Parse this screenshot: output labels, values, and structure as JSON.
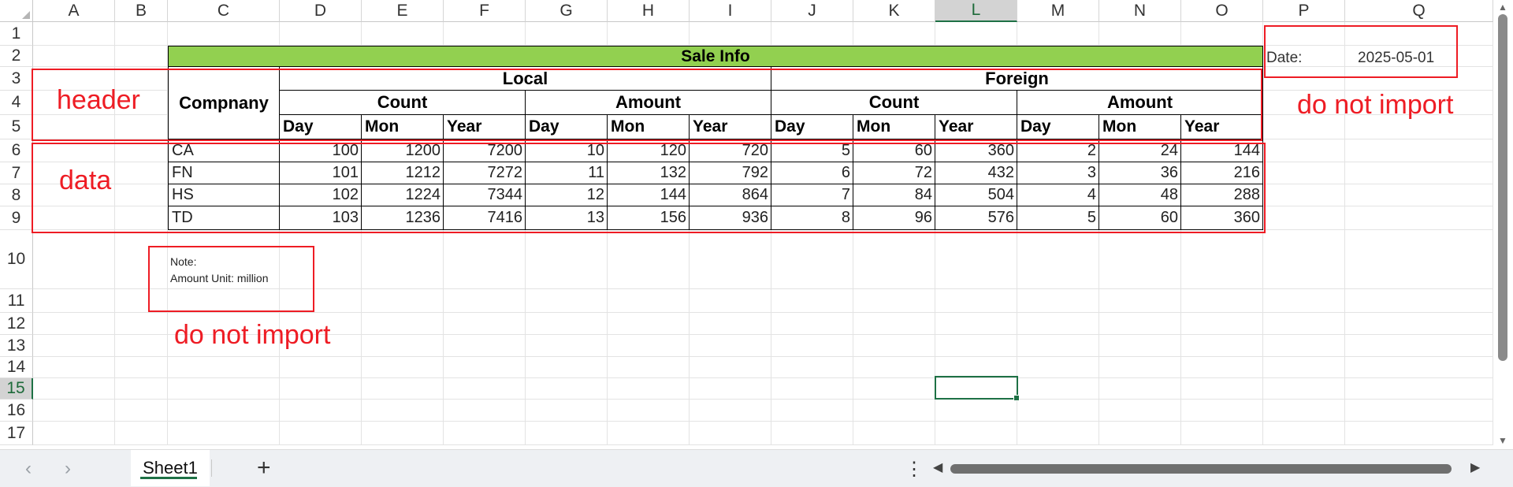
{
  "columns": [
    "A",
    "B",
    "C",
    "D",
    "E",
    "F",
    "G",
    "H",
    "I",
    "J",
    "K",
    "L",
    "M",
    "N",
    "O",
    "P",
    "Q"
  ],
  "active_column": "L",
  "rows": [
    "1",
    "2",
    "3",
    "4",
    "5",
    "6",
    "7",
    "8",
    "9",
    "10",
    "11",
    "12",
    "13",
    "14",
    "15",
    "16",
    "17"
  ],
  "active_row": "15",
  "table": {
    "title": "Sale Info",
    "company_header": "Compnany",
    "local": "Local",
    "foreign": "Foreign",
    "count": "Count",
    "amount": "Amount",
    "day": "Day",
    "mon": "Mon",
    "year": "Year",
    "data": [
      {
        "company": "CA",
        "values": [
          100,
          1200,
          7200,
          10,
          120,
          720,
          5,
          60,
          360,
          2,
          24,
          144
        ]
      },
      {
        "company": "FN",
        "values": [
          101,
          1212,
          7272,
          11,
          132,
          792,
          6,
          72,
          432,
          3,
          36,
          216
        ]
      },
      {
        "company": "HS",
        "values": [
          102,
          1224,
          7344,
          12,
          144,
          864,
          7,
          84,
          504,
          4,
          48,
          288
        ]
      },
      {
        "company": "TD",
        "values": [
          103,
          1236,
          7416,
          13,
          156,
          936,
          8,
          96,
          576,
          5,
          60,
          360
        ]
      }
    ]
  },
  "date": {
    "label": "Date:",
    "value": "2025-05-01"
  },
  "note": {
    "line1": "Note:",
    "line2": "Amount Unit: million"
  },
  "annotations": {
    "header": "header",
    "data": "data",
    "do_not_import_right": "do not import",
    "do_not_import_note": "do not import"
  },
  "accent_color": "#1e7145",
  "title_fill_color": "#92d050",
  "annotation_color": "#ee1c24",
  "sheet_tabs": [
    {
      "label": "Sheet1",
      "active": true
    }
  ],
  "icons": {
    "prev_sheet": "chevron-left-icon",
    "next_sheet": "chevron-right-icon",
    "add_sheet": "plus-icon",
    "more": "vertical-ellipsis-icon"
  }
}
